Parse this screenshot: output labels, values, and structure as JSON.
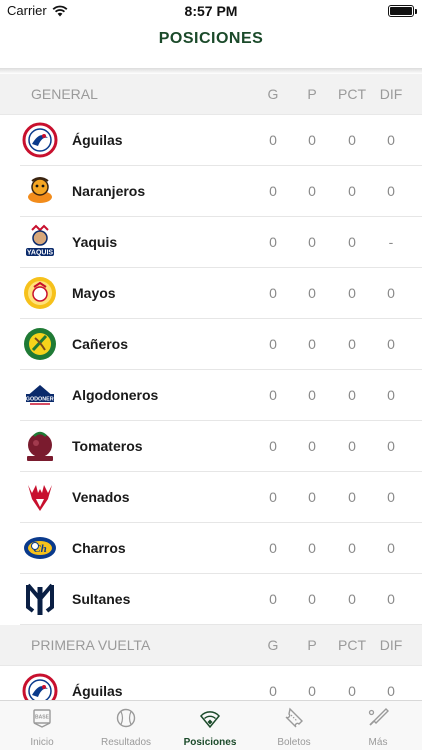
{
  "status": {
    "carrier": "Carrier",
    "time": "8:57 PM"
  },
  "nav": {
    "title": "POSICIONES"
  },
  "columns": {
    "g": "G",
    "p": "P",
    "pct": "PCT",
    "dif": "DIF"
  },
  "sections": [
    {
      "title": "GENERAL",
      "teams": [
        {
          "name": "Águilas",
          "g": "0",
          "p": "0",
          "pct": "0",
          "dif": "0",
          "logo": "aguilas-logo"
        },
        {
          "name": "Naranjeros",
          "g": "0",
          "p": "0",
          "pct": "0",
          "dif": "0",
          "logo": "naranjeros-logo"
        },
        {
          "name": "Yaquis",
          "g": "0",
          "p": "0",
          "pct": "0",
          "dif": "-",
          "logo": "yaquis-logo"
        },
        {
          "name": "Mayos",
          "g": "0",
          "p": "0",
          "pct": "0",
          "dif": "0",
          "logo": "mayos-logo"
        },
        {
          "name": "Cañeros",
          "g": "0",
          "p": "0",
          "pct": "0",
          "dif": "0",
          "logo": "caneros-logo"
        },
        {
          "name": "Algodoneros",
          "g": "0",
          "p": "0",
          "pct": "0",
          "dif": "0",
          "logo": "algodoneros-logo"
        },
        {
          "name": "Tomateros",
          "g": "0",
          "p": "0",
          "pct": "0",
          "dif": "0",
          "logo": "tomateros-logo"
        },
        {
          "name": "Venados",
          "g": "0",
          "p": "0",
          "pct": "0",
          "dif": "0",
          "logo": "venados-logo"
        },
        {
          "name": "Charros",
          "g": "0",
          "p": "0",
          "pct": "0",
          "dif": "0",
          "logo": "charros-logo"
        },
        {
          "name": "Sultanes",
          "g": "0",
          "p": "0",
          "pct": "0",
          "dif": "0",
          "logo": "sultanes-logo"
        }
      ]
    },
    {
      "title": "PRIMERA VUELTA",
      "teams": [
        {
          "name": "Águilas",
          "g": "0",
          "p": "0",
          "pct": "0",
          "dif": "0",
          "logo": "aguilas-logo"
        }
      ]
    }
  ],
  "tabs": [
    {
      "label": "Inicio",
      "icon": "base-icon",
      "active": false
    },
    {
      "label": "Resultados",
      "icon": "baseball-icon",
      "active": false
    },
    {
      "label": "Posiciones",
      "icon": "field-icon",
      "active": true
    },
    {
      "label": "Boletos",
      "icon": "ticket-icon",
      "active": false
    },
    {
      "label": "Más",
      "icon": "bat-icon",
      "active": false
    }
  ],
  "colors": {
    "accent": "#1b4a2a",
    "muted": "#9a9a9a",
    "header_bg": "#f2f2f2"
  }
}
